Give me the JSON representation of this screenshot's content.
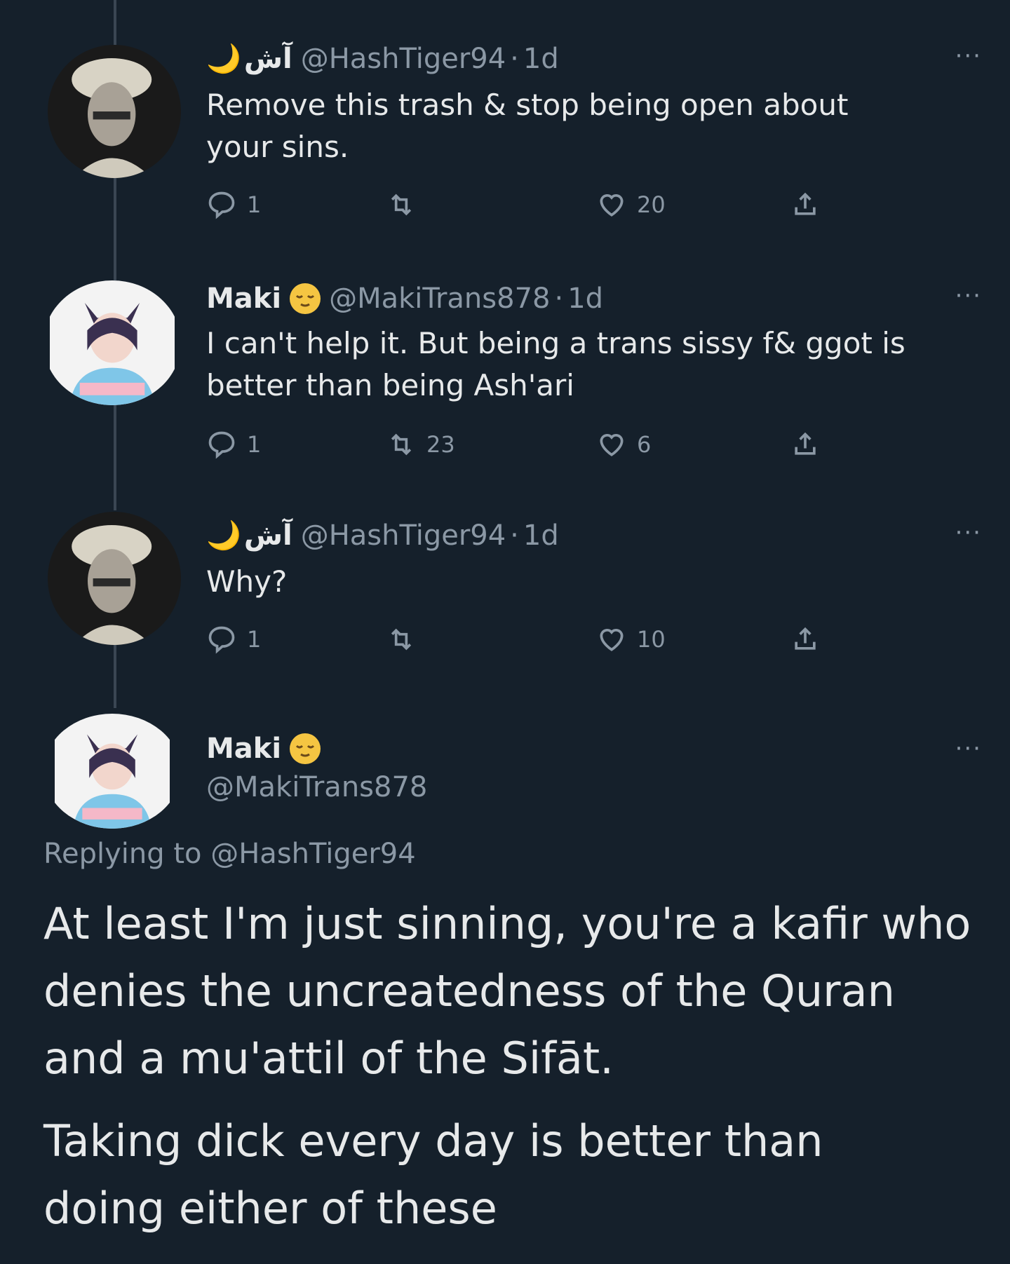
{
  "tweets": [
    {
      "name": "آش",
      "name_suffix": "🌙",
      "handle": "@HashTiger94",
      "separator": "·",
      "time": "1d",
      "text": "Remove this trash & stop being open about your sins.",
      "replies": "1",
      "retweets": "",
      "likes": "20",
      "more": "···"
    },
    {
      "name": "Maki",
      "handle": "@MakiTrans878",
      "separator": "·",
      "time": "1d",
      "text": "I can't help it. But being a trans sissy f& ggot is better than being Ash'ari",
      "replies": "1",
      "retweets": "23",
      "likes": "6",
      "more": "···"
    },
    {
      "name": "آش",
      "name_suffix": "🌙",
      "handle": "@HashTiger94",
      "separator": "·",
      "time": "1d",
      "text": "Why?",
      "replies": "1",
      "retweets": "",
      "likes": "10",
      "more": "···"
    }
  ],
  "main_tweet": {
    "name": "Maki",
    "handle": "@MakiTrans878",
    "more": "···",
    "replying_to": "Replying to @HashTiger94",
    "paragraph1": "At least I'm just sinning, you're a kafir who denies the uncreatedness of the Quran and a mu'attil of the Sifāt.",
    "paragraph2": "Taking dick every day is better than doing either of these"
  },
  "colors": {
    "background": "#15202b",
    "text": "#e7e9ea",
    "muted": "#8b98a5",
    "thread_line": "#3a4653",
    "emoji_yellow": "#f5c542"
  },
  "icons": [
    "reply-icon",
    "retweet-icon",
    "like-icon",
    "share-icon",
    "moon-icon",
    "relieved-face-icon"
  ]
}
